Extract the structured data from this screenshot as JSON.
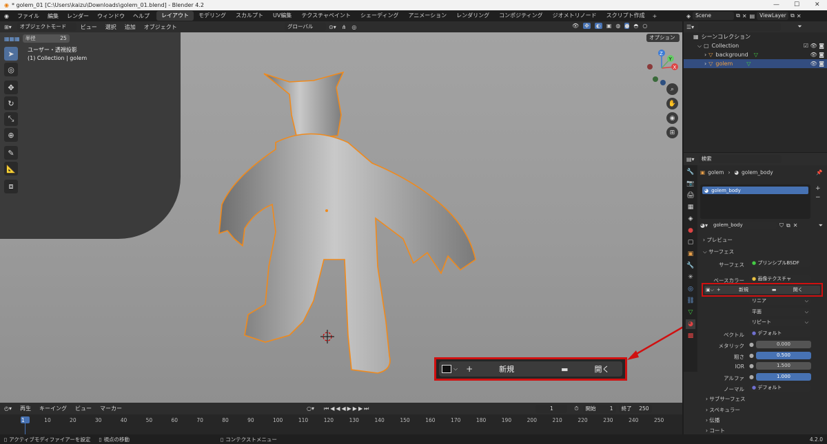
{
  "window": {
    "title": "* golem_01 [C:\\Users\\kaizu\\Downloads\\golem_01.blend] - Blender 4.2"
  },
  "menus": [
    "ファイル",
    "編集",
    "レンダー",
    "ウィンドウ",
    "ヘルプ"
  ],
  "workspaces": [
    "レイアウト",
    "モデリング",
    "スカルプト",
    "UV編集",
    "テクスチャペイント",
    "シェーディング",
    "アニメーション",
    "レンダリング",
    "コンポジティング",
    "ジオメトリノード",
    "スクリプト作成"
  ],
  "scene": {
    "name": "Scene",
    "view_layer": "ViewLayer"
  },
  "viewport_header": {
    "mode": "オブジェクトモード",
    "menus": [
      "ビュー",
      "選択",
      "追加",
      "オブジェクト"
    ],
    "transform": "グローバル",
    "options": "オプション"
  },
  "radius": {
    "label": "半径",
    "value": "25"
  },
  "viewport": {
    "view_name": "ユーザー・透視投影",
    "collection_info": "(1) Collection | golem"
  },
  "gizmo": {
    "z": "Z",
    "y": "Y",
    "x": "X"
  },
  "callout": {
    "new_label": "新規",
    "open_label": "開く"
  },
  "outliner": {
    "search_placeholder": "",
    "root": "シーンコレクション",
    "collection": "Collection",
    "items": [
      "background",
      "golem"
    ]
  },
  "properties": {
    "search_placeholder": "検索",
    "breadcrumb_obj": "golem",
    "breadcrumb_mesh": "golem_body",
    "slot": "golem_body",
    "material": "golem_body",
    "sections": {
      "preview": "プレビュー",
      "surface": "サーフェス",
      "subsurface": "サブサーフェス",
      "specular": "スペキュラー",
      "transmission": "伝播",
      "coat": "コート"
    },
    "surface_label": "サーフェス",
    "surface_value": "プリンシプルBSDF",
    "base_color_label": "ベースカラー",
    "base_color_value": "画像テクスチャ",
    "new_label": "新規",
    "open_label": "開く",
    "interp": "リニア",
    "proj": "平面",
    "ext": "リピート",
    "vector_label": "ベクトル",
    "vector_value": "デフォルト",
    "metallic_label": "メタリック",
    "metallic_value": "0.000",
    "roughness_label": "粗さ",
    "roughness_value": "0.500",
    "ior_label": "IOR",
    "ior_value": "1.500",
    "alpha_label": "アルファ",
    "alpha_value": "1.000",
    "normal_label": "ノーマル",
    "normal_value": "デフォルト"
  },
  "timeline": {
    "menus": [
      "再生",
      "キーイング",
      "ビュー",
      "マーカー"
    ],
    "current": "1",
    "start_label": "開始",
    "start": "1",
    "end_label": "終了",
    "end": "250",
    "ticks": [
      "1",
      "10",
      "20",
      "30",
      "40",
      "50",
      "60",
      "70",
      "80",
      "90",
      "100",
      "110",
      "120",
      "130",
      "140",
      "150",
      "160",
      "170",
      "180",
      "190",
      "200",
      "210",
      "220",
      "230",
      "240",
      "250"
    ]
  },
  "status": {
    "left": "アクティブモディファイアーを設定",
    "mid": "視点の移動",
    "ctx": "コンテクストメニュー",
    "version": "4.2.0"
  }
}
